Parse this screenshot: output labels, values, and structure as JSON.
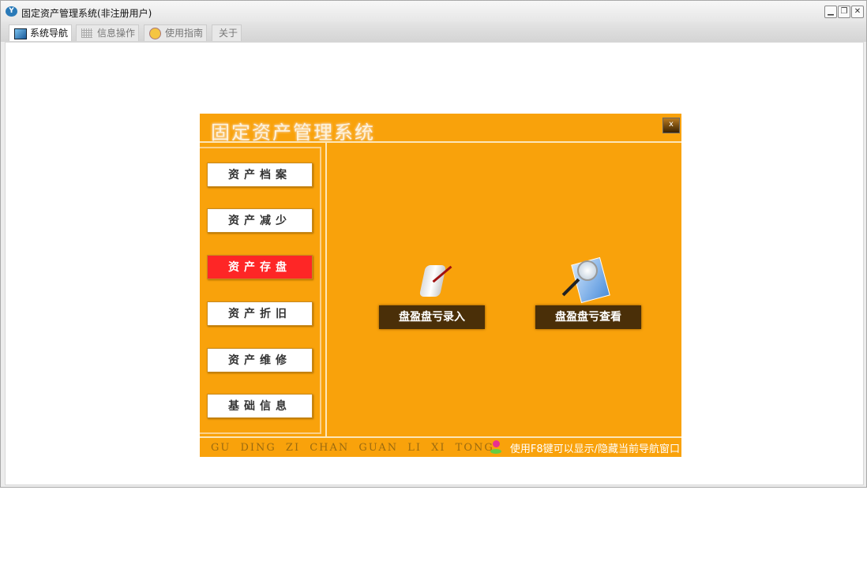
{
  "window": {
    "title": "固定资产管理系统(非注册用户)"
  },
  "tabs": [
    {
      "label": "系统导航"
    },
    {
      "label": "信息操作"
    },
    {
      "label": "使用指南"
    },
    {
      "label": "关于"
    }
  ],
  "panel": {
    "title": "固定资产管理系统",
    "close_label": "x",
    "nav": [
      {
        "label": "资产档案"
      },
      {
        "label": "资产减少"
      },
      {
        "label": "资产存盘"
      },
      {
        "label": "资产折旧"
      },
      {
        "label": "资产维修"
      },
      {
        "label": "基础信息"
      }
    ],
    "actions": [
      {
        "label": "盘盈盘亏录入"
      },
      {
        "label": "盘盈盘亏查看"
      }
    ],
    "footer_pinyin": "GU DING ZI CHAN GUAN LI XI TONG",
    "footer_tip": "使用F8键可以显示/隐藏当前导航窗口"
  },
  "colors": {
    "panel": "#f9a20b",
    "selected": "#fe2626",
    "action": "#4a2f08"
  }
}
